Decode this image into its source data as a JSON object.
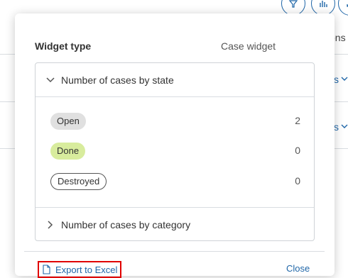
{
  "background": {
    "column_header": "ons",
    "row_links": [
      "s",
      "s"
    ],
    "icons": [
      "filter-icon",
      "bar-chart-icon",
      "expand-icon"
    ]
  },
  "widget": {
    "type_label": "Widget type",
    "type_value": "Case widget"
  },
  "sections": {
    "by_state": {
      "title": "Number of cases by state",
      "expanded": true,
      "rows": [
        {
          "label": "Open",
          "count": "2",
          "color": "#e0e0e0"
        },
        {
          "label": "Done",
          "count": "0",
          "color": "#d8ec9d"
        },
        {
          "label": "Destroyed",
          "count": "0",
          "color": "#ffffff"
        }
      ]
    },
    "by_category": {
      "title": "Number of cases by category",
      "expanded": false
    }
  },
  "footer": {
    "export_label": "Export to Excel",
    "close_label": "Close"
  },
  "colors": {
    "link": "#1f66a8",
    "highlight_border": "#e00000"
  }
}
